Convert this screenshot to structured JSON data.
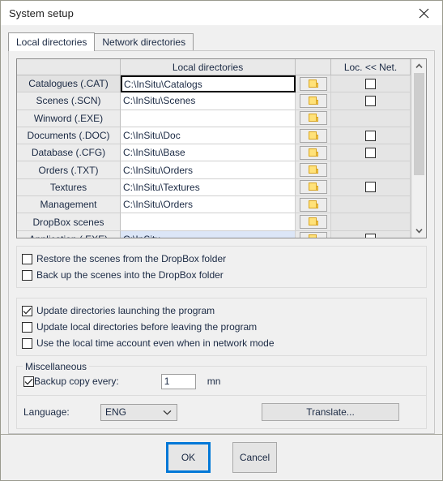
{
  "window": {
    "title": "System setup",
    "close_icon": "close-icon"
  },
  "tabs": [
    {
      "label": "Local directories",
      "active": true
    },
    {
      "label": "Network directories",
      "active": false
    }
  ],
  "grid": {
    "headers": {
      "name": "",
      "path": "Local directories",
      "browse": "",
      "net": "Loc. << Net."
    },
    "rows": [
      {
        "label": "Catalogues (.CAT)",
        "path": "C:\\InSitu\\Catalogs",
        "browse_icon": "folder-icon",
        "has_net": true,
        "net_checked": false,
        "focused": true,
        "selected": false
      },
      {
        "label": "Scenes (.SCN)",
        "path": "C:\\InSitu\\Scenes",
        "browse_icon": "folder-icon",
        "has_net": true,
        "net_checked": false,
        "focused": false,
        "selected": false
      },
      {
        "label": "Winword (.EXE)",
        "path": "",
        "browse_icon": "folder-icon",
        "has_net": false,
        "net_checked": false,
        "focused": false,
        "selected": false
      },
      {
        "label": "Documents (.DOC)",
        "path": "C:\\InSitu\\Doc",
        "browse_icon": "folder-icon",
        "has_net": true,
        "net_checked": false,
        "focused": false,
        "selected": false
      },
      {
        "label": "Database (.CFG)",
        "path": "C:\\InSitu\\Base",
        "browse_icon": "folder-icon",
        "has_net": true,
        "net_checked": false,
        "focused": false,
        "selected": false
      },
      {
        "label": "Orders (.TXT)",
        "path": "C:\\InSitu\\Orders",
        "browse_icon": "folder-icon",
        "has_net": false,
        "net_checked": false,
        "focused": false,
        "selected": false
      },
      {
        "label": "Textures",
        "path": "C:\\InSitu\\Textures",
        "browse_icon": "folder-icon",
        "has_net": true,
        "net_checked": false,
        "focused": false,
        "selected": false
      },
      {
        "label": "Management",
        "path": "C:\\InSitu\\Orders",
        "browse_icon": "folder-icon",
        "has_net": false,
        "net_checked": false,
        "focused": false,
        "selected": false
      },
      {
        "label": "DropBox scenes",
        "path": "",
        "browse_icon": "folder-icon",
        "has_net": false,
        "net_checked": false,
        "focused": false,
        "selected": false
      },
      {
        "label": "Application (.EXE)",
        "path": "C:\\InSitu",
        "browse_icon": "folder-icon",
        "has_net": true,
        "net_checked": false,
        "focused": false,
        "selected": true
      }
    ],
    "scrollbar": {
      "up_icon": "chevron-up-icon",
      "down_icon": "chevron-down-icon",
      "thumb_percent": 68
    }
  },
  "dropbox_options": [
    {
      "label": "Restore the scenes from the DropBox folder",
      "checked": false
    },
    {
      "label": "Back up the scenes into the DropBox folder",
      "checked": false
    }
  ],
  "update_options": [
    {
      "label": "Update directories launching the program",
      "checked": true
    },
    {
      "label": "Update local directories before leaving the program",
      "checked": false
    },
    {
      "label": "Use the local time account even when in network mode",
      "checked": false
    }
  ],
  "miscellaneous": {
    "title": "Miscellaneous",
    "backup": {
      "label": "Backup copy every:",
      "checked": true,
      "value": "1",
      "unit": "mn"
    },
    "language": {
      "label": "Language:",
      "selected": "ENG",
      "chevron_icon": "chevron-down-icon"
    },
    "translate_label": "Translate..."
  },
  "footer": {
    "ok_label": "OK",
    "cancel_label": "Cancel"
  },
  "colors": {
    "accent_focus": "#0078d7",
    "selection_row": "#dce6f7",
    "folder_yellow": "#ffe27a",
    "dialog_bg": "#f0f0f0"
  }
}
